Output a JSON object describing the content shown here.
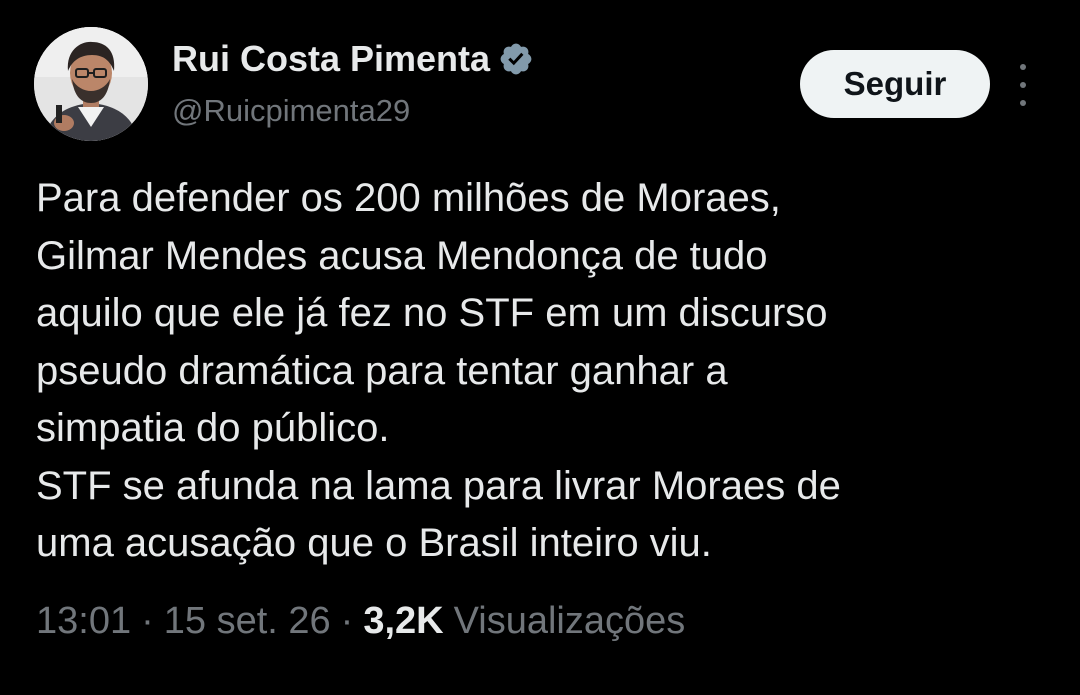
{
  "author": {
    "display_name": "Rui Costa Pimenta",
    "handle": "@Ruicpimenta29",
    "verified": true,
    "avatar_icon": "profile-photo"
  },
  "actions": {
    "follow_label": "Seguir",
    "more_icon": "more-vertical-icon"
  },
  "tweet": {
    "lines": [
      "Para defender os 200 milhões de Moraes,",
      "Gilmar Mendes acusa Mendonça de tudo",
      "aquilo que ele já fez no STF em um discurso",
      "pseudo dramática para tentar ganhar a",
      "simpatia do público.",
      "STF se afunda na lama para livrar Moraes de",
      "uma acusação que o Brasil inteiro viu."
    ]
  },
  "meta": {
    "time": "13:01",
    "date": "15 set. 26",
    "separator": "·",
    "views_count": "3,2K",
    "views_label": "Visualizações"
  },
  "colors": {
    "background": "#000000",
    "primary_text": "#e7e9ea",
    "secondary_text": "#71767b",
    "follow_button_bg": "#eff3f4",
    "verified_badge": "#829aab"
  }
}
